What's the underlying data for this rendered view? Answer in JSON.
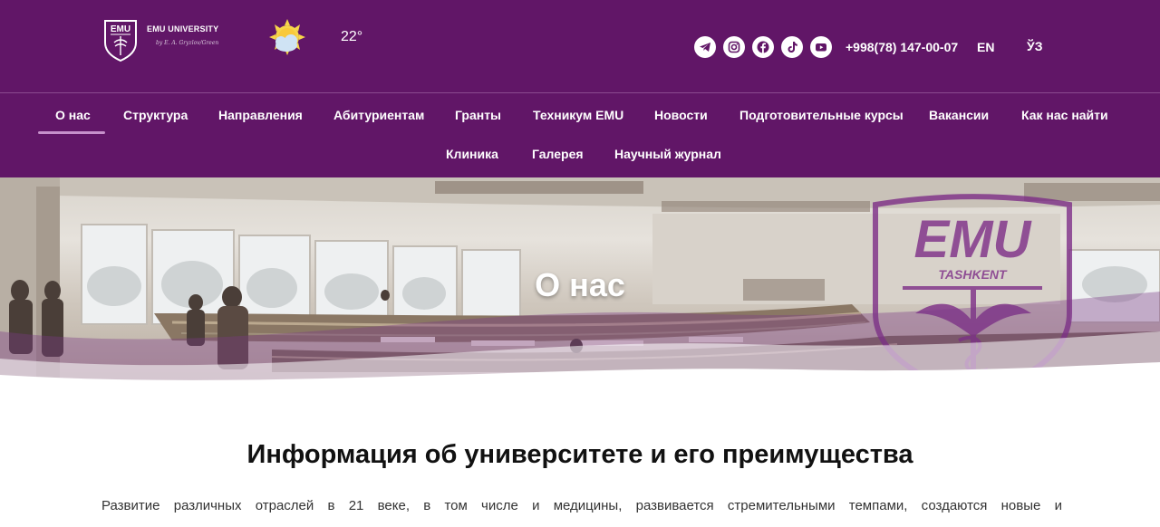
{
  "header": {
    "logo_name": "EMU UNIVERSITY",
    "logo_signature": "by E. A. Gryzlov/Green",
    "temperature": "22°",
    "weather_icon": "sun-behind-cloud-icon",
    "socials": [
      "telegram-icon",
      "instagram-icon",
      "facebook-icon",
      "tiktok-icon",
      "youtube-icon"
    ],
    "phone": "+998(78) 147-00-07",
    "lang_en": "EN",
    "lang_uz": "ЎЗ"
  },
  "nav": {
    "items": [
      {
        "label": "О нас"
      },
      {
        "label": "Структура"
      },
      {
        "label": "Направления"
      },
      {
        "label": "Абитуриентам"
      },
      {
        "label": "Гранты"
      },
      {
        "label": "Техникум EMU"
      },
      {
        "label": "Новости"
      },
      {
        "label": "Подготовительные курсы"
      },
      {
        "label": "Вакансии"
      },
      {
        "label": "Как нас найти"
      },
      {
        "label": "Клиника"
      },
      {
        "label": "Галерея"
      },
      {
        "label": "Научный журнал"
      }
    ],
    "active": "О нас"
  },
  "hero": {
    "title": "О нас",
    "emblem_text": "EMU",
    "emblem_subtext": "TASHKENT"
  },
  "content": {
    "heading": "Информация об университете и его преимущества",
    "paragraph": "Развитие различных отраслей в 21 веке, в том числе и медицины, развивается стремительными темпами, создаются новые и"
  },
  "colors": {
    "brand_purple": "#611667",
    "active_underline": "#c691cb"
  }
}
